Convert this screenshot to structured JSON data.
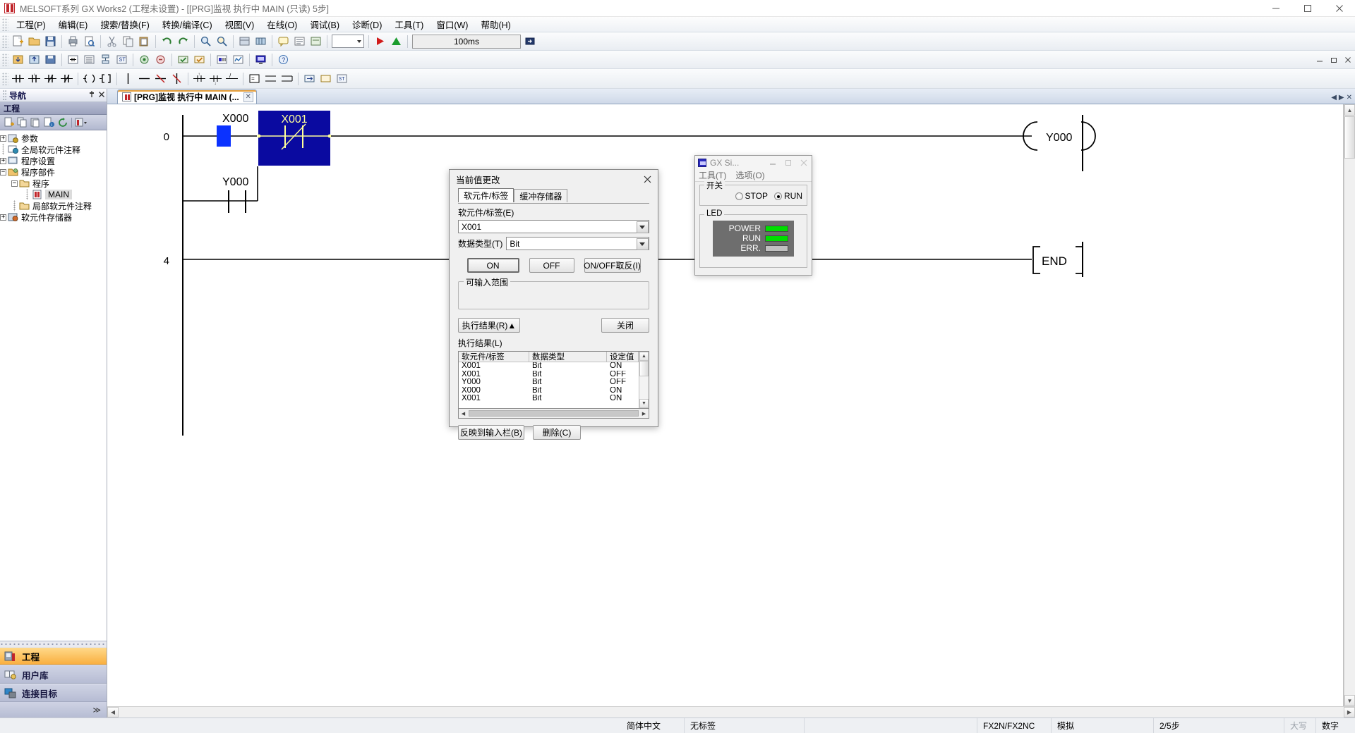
{
  "window": {
    "title": "MELSOFT系列 GX Works2 (工程未设置) - [[PRG]监视 执行中 MAIN (只读) 5步]",
    "minimize": "–",
    "maximize": "□",
    "close": "✕"
  },
  "menu": {
    "items": [
      "工程(P)",
      "编辑(E)",
      "搜索/替换(F)",
      "转换/编译(C)",
      "视图(V)",
      "在线(O)",
      "调试(B)",
      "诊断(D)",
      "工具(T)",
      "窗口(W)",
      "帮助(H)"
    ]
  },
  "toolbar": {
    "scan_time": "100ms",
    "zoom_value": "",
    "inner_minimize": "–",
    "inner_restore": "□",
    "inner_close": "✕"
  },
  "navigation": {
    "header": "导航",
    "pin": "📌",
    "close": "✕",
    "subheader": "工程",
    "tree": [
      {
        "label": "参数",
        "level": 0,
        "expander": "+",
        "icon": "parameter-icon"
      },
      {
        "label": "全局软元件注释",
        "level": 0,
        "expander": "",
        "icon": "comment-icon"
      },
      {
        "label": "程序设置",
        "level": 0,
        "expander": "+",
        "icon": "program-setting-icon"
      },
      {
        "label": "程序部件",
        "level": 0,
        "expander": "-",
        "icon": "pou-icon"
      },
      {
        "label": "程序",
        "level": 1,
        "expander": "-",
        "icon": "folder-icon"
      },
      {
        "label": "MAIN",
        "level": 2,
        "expander": "",
        "icon": "ladder-file-icon",
        "selected": true
      },
      {
        "label": "局部软元件注释",
        "level": 1,
        "expander": "",
        "icon": "comment-icon"
      },
      {
        "label": "软元件存储器",
        "level": 0,
        "expander": "+",
        "icon": "device-memory-icon"
      }
    ],
    "buttons": [
      {
        "label": "工程",
        "icon": "project-icon",
        "active": true
      },
      {
        "label": "用户库",
        "icon": "library-icon",
        "active": false
      },
      {
        "label": "连接目标",
        "icon": "connection-icon",
        "active": false
      }
    ],
    "more": "≫"
  },
  "tab": {
    "label": "[PRG]监视 执行中 MAIN (...",
    "close": "✕"
  },
  "ladder": {
    "rungs": [
      {
        "step": "0"
      },
      {
        "step": "4"
      }
    ],
    "contacts": {
      "x000": "X000",
      "x001": "X001",
      "y000_contact": "Y000",
      "y000_coil": "Y000",
      "end": "END"
    }
  },
  "dialog": {
    "title": "当前值更改",
    "close": "✕",
    "tabs": [
      {
        "label": "软元件/标签",
        "active": true
      },
      {
        "label": "缓冲存储器",
        "active": false
      }
    ],
    "device_label_caption": "软元件/标签(E)",
    "device_label_value": "X001",
    "data_type_caption": "数据类型(T)",
    "data_type_value": "Bit",
    "buttons": {
      "on": "ON",
      "off": "OFF",
      "toggle": "ON/OFF取反(I)",
      "result_toggle": "执行结果(R)▲",
      "close": "关闭",
      "reflect": "反映到输入栏(B)",
      "delete": "删除(C)"
    },
    "input_range_caption": "可输入范围",
    "input_range_value": "",
    "result_caption": "执行结果(L)",
    "result_columns": [
      "软元件/标签",
      "数据类型",
      "设定值"
    ],
    "result_rows": [
      [
        "X001",
        "Bit",
        "ON"
      ],
      [
        "X001",
        "Bit",
        "OFF"
      ],
      [
        "Y000",
        "Bit",
        "OFF"
      ],
      [
        "X000",
        "Bit",
        "ON"
      ],
      [
        "X001",
        "Bit",
        "ON"
      ]
    ]
  },
  "simulator": {
    "title": "GX Si...",
    "minimize": "–",
    "maximize": "□",
    "close": "✕",
    "menu": [
      "工具(T)",
      "选项(O)"
    ],
    "switch_caption": "开关",
    "switch_options": [
      {
        "label": "STOP",
        "selected": false
      },
      {
        "label": "RUN",
        "selected": true
      }
    ],
    "led_caption": "LED",
    "leds": [
      {
        "label": "POWER",
        "color": "#00dd00",
        "on": true
      },
      {
        "label": "RUN",
        "color": "#00dd00",
        "on": true
      },
      {
        "label": "ERR.",
        "color": "#c0c0c0",
        "on": false
      }
    ]
  },
  "statusbar": {
    "language": "简体中文",
    "label_state": "无标签",
    "blank": "",
    "plc_type": "FX2N/FX2NC",
    "connection": "模拟",
    "steps": "2/5步",
    "caps": "大写",
    "num": "数字"
  },
  "colors": {
    "accent_orange": "#f9ae3d",
    "monitor_blue": "#0a0aa0",
    "cursor_blue": "#0b32ff",
    "led_green": "#00dd00",
    "led_off": "#c0c0c0"
  }
}
